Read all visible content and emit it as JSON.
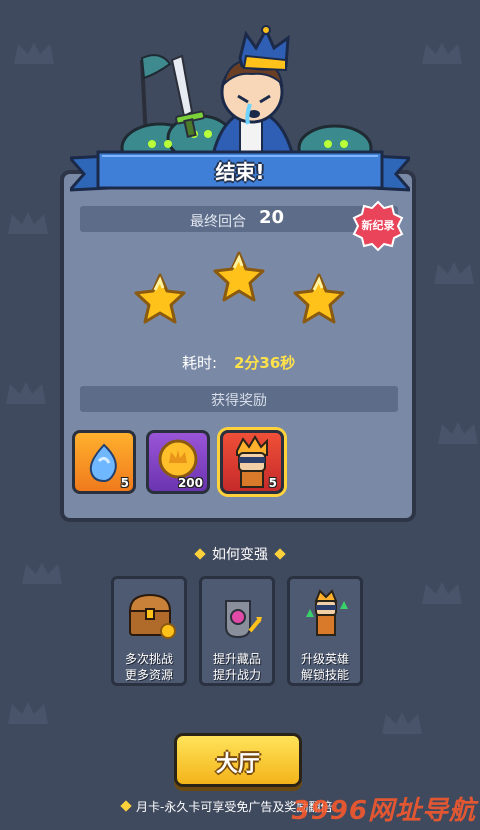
{
  "header": {
    "title": "结束!"
  },
  "summary": {
    "round_label": "最终回合",
    "round_value": "20",
    "new_record_badge": "新纪录",
    "stars_earned": 3,
    "time_label": "耗时:",
    "time_value": "2分36秒"
  },
  "rewards": {
    "title": "获得奖励",
    "items": [
      {
        "icon": "blue-spirit-icon",
        "count": "5",
        "color": "orange"
      },
      {
        "icon": "crown-coin-icon",
        "count": "200",
        "color": "purple"
      },
      {
        "icon": "hero-ninja-icon",
        "count": "5",
        "color": "red"
      }
    ]
  },
  "how_to_strengthen": {
    "title": "如何变强",
    "tips": [
      {
        "icon": "treasure-chest-icon",
        "label": "多次挑战\n更多资源"
      },
      {
        "icon": "gauntlet-icon",
        "label": "提升藏品\n提升战力"
      },
      {
        "icon": "hero-upgrade-icon",
        "label": "升级英雄\n解锁技能"
      }
    ]
  },
  "lobby_button": {
    "label": "大厅"
  },
  "footer": {
    "note": "月卡-永久卡可享受免广告及奖励翻倍"
  },
  "watermark": "3996网址导航",
  "colors": {
    "background": "#404a5e",
    "panel": "#7a8aa6",
    "ribbon": "#3f7fd8",
    "star": "#ffc21a",
    "button": "#ffd23b",
    "time": "#ffe24a"
  }
}
